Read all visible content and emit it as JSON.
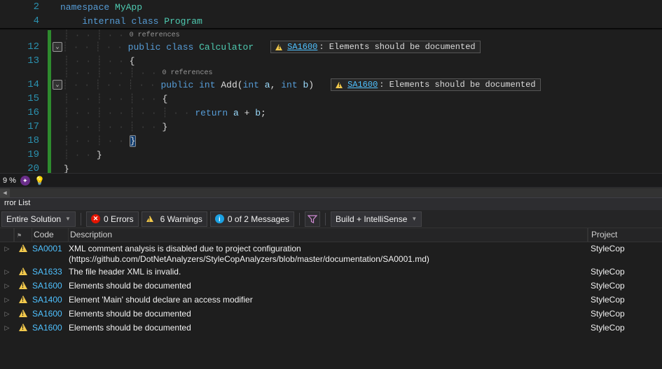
{
  "editor": {
    "lines": [
      {
        "num": "2",
        "indent": "",
        "tokens": [
          [
            "kw",
            "namespace"
          ],
          [
            "",
            ""
          ],
          [
            "type",
            "MyApp"
          ]
        ]
      },
      {
        "num": "4",
        "indent": "    ",
        "tokens": [
          [
            "kw",
            "internal"
          ],
          [
            "",
            ""
          ],
          [
            "kw",
            "class"
          ],
          [
            "",
            ""
          ],
          [
            "type",
            "Program"
          ]
        ]
      }
    ],
    "body": [
      {
        "num": "12",
        "fold": true,
        "guides": "┊ · · ┊ · · ",
        "tokens": [
          [
            "kw",
            "public"
          ],
          [
            "",
            ""
          ],
          [
            "kw",
            "class"
          ],
          [
            "",
            ""
          ],
          [
            "type",
            "Calculator"
          ]
        ],
        "warn": {
          "code": "SA1600",
          "msg": "Elements should be documented"
        },
        "refs": "0 references",
        "refs_above": true
      },
      {
        "num": "13",
        "guides": "┊ · · ┊ · · ",
        "tokens": [
          [
            "punct",
            "{"
          ]
        ]
      },
      {
        "num": "14",
        "fold": true,
        "guides": "┊ · · ┊ · · ┊ · · ",
        "tokens": [
          [
            "kw",
            "public"
          ],
          [
            "",
            ""
          ],
          [
            "kw",
            "int"
          ],
          [
            "",
            ""
          ],
          [
            "ident",
            "Add"
          ],
          [
            "punct",
            "("
          ],
          [
            "kw",
            "int"
          ],
          [
            "",
            ""
          ],
          [
            "param",
            "a"
          ],
          [
            "punct",
            ","
          ],
          [
            "",
            ""
          ],
          [
            "kw",
            "int"
          ],
          [
            "",
            ""
          ],
          [
            "param",
            "b"
          ],
          [
            "punct",
            ")"
          ]
        ],
        "warn": {
          "code": "SA1600",
          "msg": "Elements should be documented"
        },
        "refs": "0 references",
        "refs_above": true
      },
      {
        "num": "15",
        "guides": "┊ · · ┊ · · ┊ · · ",
        "tokens": [
          [
            "punct",
            "{"
          ]
        ]
      },
      {
        "num": "16",
        "guides": "┊ · · ┊ · · ┊ · · ┊ · · ",
        "tokens": [
          [
            "kw",
            "return"
          ],
          [
            "",
            ""
          ],
          [
            "param",
            "a"
          ],
          [
            "",
            ""
          ],
          [
            "punct",
            "+"
          ],
          [
            "",
            ""
          ],
          [
            "param",
            "b"
          ],
          [
            "punct",
            ";"
          ]
        ]
      },
      {
        "num": "17",
        "guides": "┊ · · ┊ · · ┊ · · ",
        "tokens": [
          [
            "punct",
            "}"
          ]
        ]
      },
      {
        "num": "18",
        "guides": "┊ · · ┊ · · ",
        "tokens": [
          [
            "brace-hl",
            "}"
          ]
        ]
      },
      {
        "num": "19",
        "guides": "┊ · · ",
        "tokens": [
          [
            "punct",
            "}"
          ]
        ]
      },
      {
        "num": "20",
        "guides": "",
        "tokens": [
          [
            "punct",
            "}"
          ]
        ]
      }
    ]
  },
  "status": {
    "zoom": "9 %"
  },
  "panel": {
    "title": "rror List"
  },
  "toolbar": {
    "scope": "Entire Solution",
    "errors": "0 Errors",
    "warnings": "6 Warnings",
    "messages": "0 of 2 Messages",
    "mode": "Build + IntelliSense"
  },
  "columns": {
    "code": "Code",
    "description": "Description",
    "project": "Project"
  },
  "rows": [
    {
      "code": "SA0001",
      "desc": "XML comment analysis is disabled due to project configuration (https://github.com/DotNetAnalyzers/StyleCopAnalyzers/blob/master/documentation/SA0001.md)",
      "project": "StyleCop"
    },
    {
      "code": "SA1633",
      "desc": "The file header XML is invalid.",
      "project": "StyleCop"
    },
    {
      "code": "SA1600",
      "desc": "Elements should be documented",
      "project": "StyleCop"
    },
    {
      "code": "SA1400",
      "desc": "Element 'Main' should declare an access modifier",
      "project": "StyleCop"
    },
    {
      "code": "SA1600",
      "desc": "Elements should be documented",
      "project": "StyleCop"
    },
    {
      "code": "SA1600",
      "desc": "Elements should be documented",
      "project": "StyleCop"
    }
  ]
}
